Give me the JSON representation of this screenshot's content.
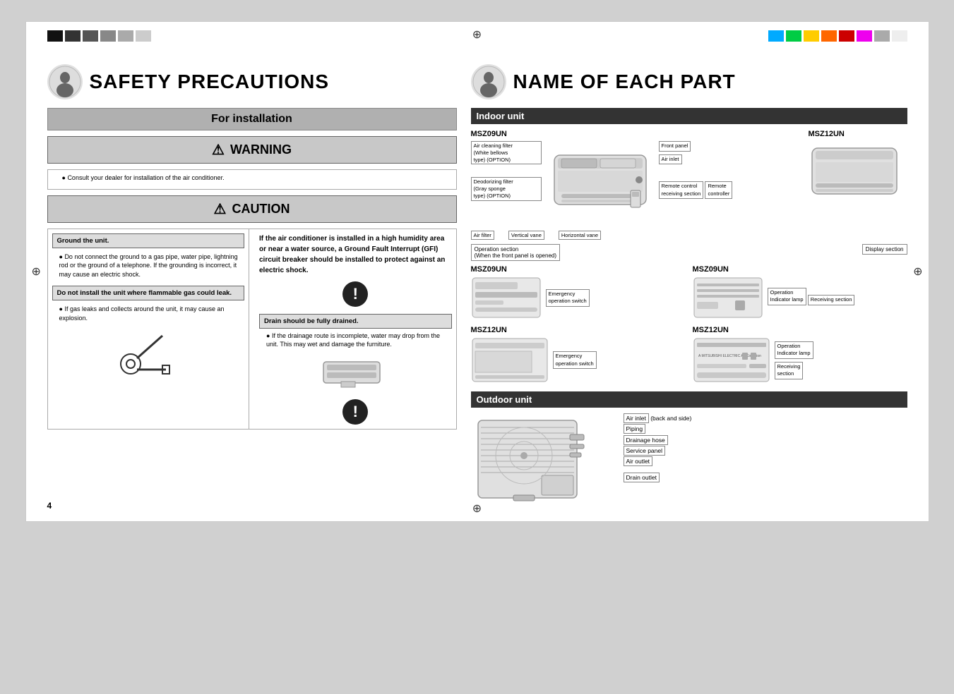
{
  "page": {
    "number": "4"
  },
  "colorBarsLeft": [
    "#000000",
    "#333333",
    "#555555",
    "#777777",
    "#999999",
    "#bbbbbb"
  ],
  "colorBarsRight": [
    "#00aaff",
    "#00cc44",
    "#ffcc00",
    "#ff6600",
    "#cc0000",
    "#ee00ee",
    "#aaaaaa",
    "#ffffff"
  ],
  "safety": {
    "title": "SAFETY PRECAUTIONS",
    "icon": "👤",
    "forInstallation": "For installation",
    "warning": {
      "label": "WARNING",
      "triangle": "⚠",
      "consultText": "Consult your dealer for installation of the air conditioner."
    },
    "caution": {
      "label": "CAUTION",
      "triangle": "⚠",
      "ground": {
        "title": "Ground the unit.",
        "text": "Do not connect the ground to a gas pipe, water pipe, lightning rod or the ground of a telephone. If the grounding is incorrect, it may cause an electric shock."
      },
      "flammable": {
        "title": "Do not install the unit where flammable gas could leak.",
        "text": "If gas leaks and collects around the unit, it may cause an explosion."
      },
      "highHumidity": {
        "text": "If the air conditioner is installed in a high humidity area or near a water source, a Ground Fault Interrupt (GFI) circuit breaker should be installed to protect against an electric shock."
      },
      "drain": {
        "title": "Drain should be fully drained.",
        "text": "If the drainage route is incomplete, water may drop from the unit. This may wet and damage the furniture."
      }
    }
  },
  "nameOfEachPart": {
    "title": "NAME OF EACH PART",
    "icon": "👤",
    "indoorUnit": {
      "header": "Indoor unit",
      "model1": "MSZ09UN",
      "model2": "MSZ12UN",
      "labels": {
        "airCleaningFilter": "Air cleaning filter\n(White bellows\ntype) (OPTION)",
        "deodorizingFilter": "Deodorizing filter\n(Gray sponge\ntype) (OPTION)",
        "airFilter": "Air filter",
        "verticalVane": "Vertical vane",
        "horizontalVane": "Horizontal vane",
        "frontPanel": "Front panel",
        "airInlet": "Air inlet",
        "remoteControlReceiving": "Remote control\nreceiving section",
        "remoteController": "Remote\ncontroller"
      },
      "operationSection": {
        "label": "Operation section",
        "note": "(When the front panel is opened)",
        "displaySection": "Display section",
        "models": [
          {
            "name": "MSZ09UN",
            "emergencySwitch": "Emergency\noperation switch",
            "operationIndicator": "Operation\nIndicator lamp",
            "receivingSection": "Receiving section"
          },
          {
            "name": "MSZ12UN",
            "emergencySwitch": "Emergency\noperation switch",
            "operationIndicator": "Operation\nIndicator lamp",
            "receivingSection": "Receiving\nsection"
          }
        ]
      }
    },
    "outdoorUnit": {
      "header": "Outdoor unit",
      "labels": {
        "airInlet": "Air inlet",
        "airInletNote": "(back and side)",
        "piping": "Piping",
        "drainageHose": "Drainage hose",
        "servicePanel": "Service panel",
        "airOutlet": "Air outlet",
        "drainOutlet": "Drain outlet"
      }
    }
  }
}
